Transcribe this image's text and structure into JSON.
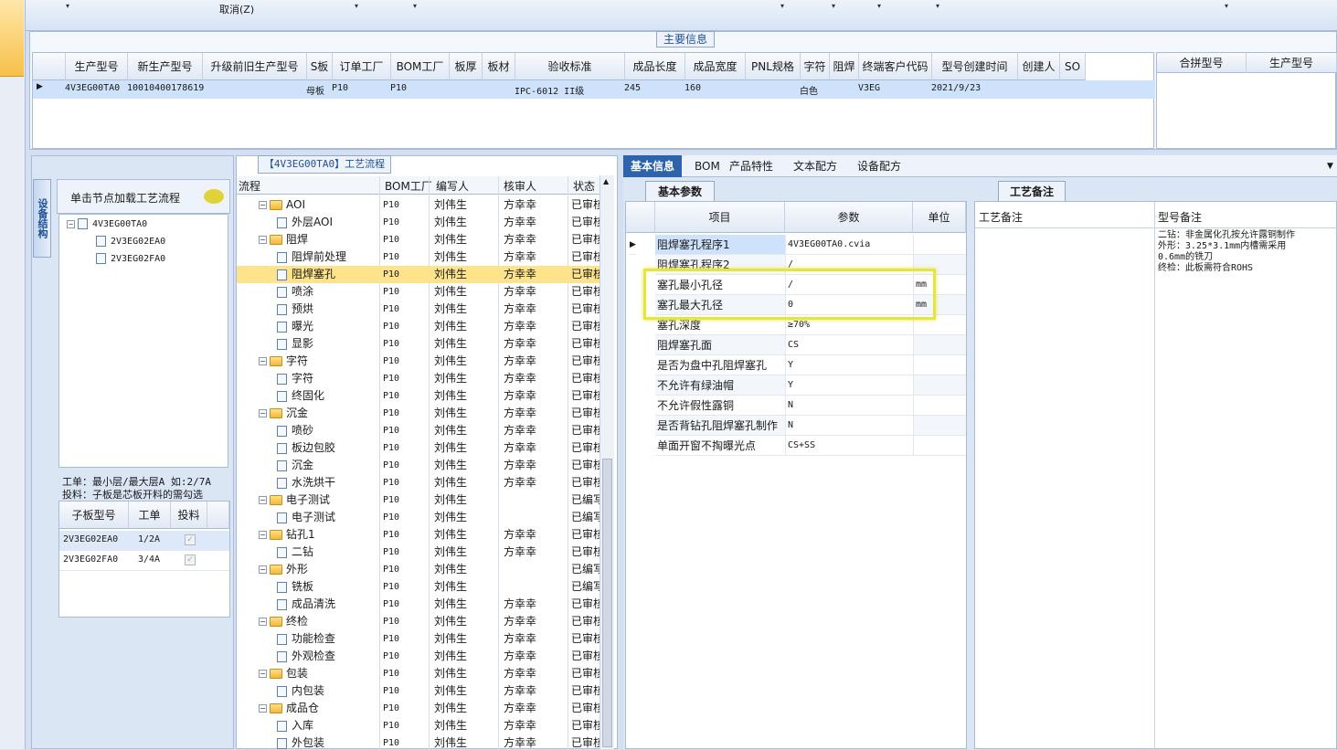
{
  "toolbar": {
    "cancel_label": "取消(Z)"
  },
  "main_info": {
    "title": "主要信息",
    "columns": [
      "生产型号",
      "新生产型号",
      "升级前旧生产型号",
      "S板",
      "订单工厂",
      "BOM工厂",
      "板厚",
      "板材",
      "验收标准",
      "成品长度",
      "成品宽度",
      "PNL规格",
      "字符",
      "阻焊",
      "终端客户代码",
      "型号创建时间",
      "创建人",
      "SO"
    ],
    "row": {
      "生产型号": "4V3EG00TA0",
      "新生产型号": "10010400178619",
      "S板": "母板",
      "订单工厂": "P10",
      "BOM工厂": "P10",
      "验收标准": "IPC-6012 II级",
      "成品长度": "245",
      "成品宽度": "160",
      "字符": "白色",
      "终端客户代码": "V3EG",
      "型号创建时间": "2021/9/23"
    },
    "merge_columns": [
      "合拼型号",
      "生产型号"
    ]
  },
  "left": {
    "vertical_tab": "设备结构",
    "click_hint": "单击节点加载工艺流程",
    "tree": [
      "4V3EG00TA0",
      "2V3EG02EA0",
      "2V3EG02FA0"
    ],
    "note_line1": "工单：最小层/最大层A 如:2/7A",
    "note_line2": "投料：子板是芯板开料的需勾选",
    "subgrid_columns": [
      "子板型号",
      "工单",
      "投料"
    ],
    "subgrid_rows": [
      {
        "model": "2V3EG02EA0",
        "ticket": "1/2A"
      },
      {
        "model": "2V3EG02FA0",
        "ticket": "3/4A"
      }
    ]
  },
  "process": {
    "title": "【4V3EG00TA0】工艺流程",
    "columns": [
      "流程",
      "BOM工厂",
      "编写人",
      "核审人",
      "状态"
    ],
    "rows": [
      {
        "name": "AOI",
        "level": 0,
        "factory": "P10",
        "writer": "刘伟生",
        "reviewer": "方幸幸",
        "status": "已审核"
      },
      {
        "name": "外层AOI",
        "level": 1,
        "factory": "P10",
        "writer": "刘伟生",
        "reviewer": "方幸幸",
        "status": "已审核"
      },
      {
        "name": "阻焊",
        "level": 0,
        "factory": "P10",
        "writer": "刘伟生",
        "reviewer": "方幸幸",
        "status": "已审核"
      },
      {
        "name": "阻焊前处理",
        "level": 1,
        "factory": "P10",
        "writer": "刘伟生",
        "reviewer": "方幸幸",
        "status": "已审核"
      },
      {
        "name": "阻焊塞孔",
        "level": 1,
        "factory": "P10",
        "writer": "刘伟生",
        "reviewer": "方幸幸",
        "status": "已审核",
        "selected": true
      },
      {
        "name": "喷涂",
        "level": 1,
        "factory": "P10",
        "writer": "刘伟生",
        "reviewer": "方幸幸",
        "status": "已审核"
      },
      {
        "name": "预烘",
        "level": 1,
        "factory": "P10",
        "writer": "刘伟生",
        "reviewer": "方幸幸",
        "status": "已审核"
      },
      {
        "name": "曝光",
        "level": 1,
        "factory": "P10",
        "writer": "刘伟生",
        "reviewer": "方幸幸",
        "status": "已审核"
      },
      {
        "name": "显影",
        "level": 1,
        "factory": "P10",
        "writer": "刘伟生",
        "reviewer": "方幸幸",
        "status": "已审核"
      },
      {
        "name": "字符",
        "level": 0,
        "factory": "P10",
        "writer": "刘伟生",
        "reviewer": "方幸幸",
        "status": "已审核"
      },
      {
        "name": "字符",
        "level": 1,
        "factory": "P10",
        "writer": "刘伟生",
        "reviewer": "方幸幸",
        "status": "已审核"
      },
      {
        "name": "终固化",
        "level": 1,
        "factory": "P10",
        "writer": "刘伟生",
        "reviewer": "方幸幸",
        "status": "已审核"
      },
      {
        "name": "沉金",
        "level": 0,
        "factory": "P10",
        "writer": "刘伟生",
        "reviewer": "方幸幸",
        "status": "已审核"
      },
      {
        "name": "喷砂",
        "level": 1,
        "factory": "P10",
        "writer": "刘伟生",
        "reviewer": "方幸幸",
        "status": "已审核"
      },
      {
        "name": "板边包胶",
        "level": 1,
        "factory": "P10",
        "writer": "刘伟生",
        "reviewer": "方幸幸",
        "status": "已审核"
      },
      {
        "name": "沉金",
        "level": 1,
        "factory": "P10",
        "writer": "刘伟生",
        "reviewer": "方幸幸",
        "status": "已审核"
      },
      {
        "name": "水洗烘干",
        "level": 1,
        "factory": "P10",
        "writer": "刘伟生",
        "reviewer": "方幸幸",
        "status": "已审核"
      },
      {
        "name": "电子测试",
        "level": 0,
        "factory": "P10",
        "writer": "刘伟生",
        "reviewer": "",
        "status": "已编写"
      },
      {
        "name": "电子测试",
        "level": 1,
        "factory": "P10",
        "writer": "刘伟生",
        "reviewer": "",
        "status": "已编写"
      },
      {
        "name": "钻孔1",
        "level": 0,
        "factory": "P10",
        "writer": "刘伟生",
        "reviewer": "方幸幸",
        "status": "已审核"
      },
      {
        "name": "二钻",
        "level": 1,
        "factory": "P10",
        "writer": "刘伟生",
        "reviewer": "方幸幸",
        "status": "已审核"
      },
      {
        "name": "外形",
        "level": 0,
        "factory": "P10",
        "writer": "刘伟生",
        "reviewer": "",
        "status": "已编写"
      },
      {
        "name": "铣板",
        "level": 1,
        "factory": "P10",
        "writer": "刘伟生",
        "reviewer": "",
        "status": "已编写"
      },
      {
        "name": "成品清洗",
        "level": 1,
        "factory": "P10",
        "writer": "刘伟生",
        "reviewer": "方幸幸",
        "status": "已审核"
      },
      {
        "name": "终检",
        "level": 0,
        "factory": "P10",
        "writer": "刘伟生",
        "reviewer": "方幸幸",
        "status": "已审核"
      },
      {
        "name": "功能检查",
        "level": 1,
        "factory": "P10",
        "writer": "刘伟生",
        "reviewer": "方幸幸",
        "status": "已审核"
      },
      {
        "name": "外观检查",
        "level": 1,
        "factory": "P10",
        "writer": "刘伟生",
        "reviewer": "方幸幸",
        "status": "已审核"
      },
      {
        "name": "包装",
        "level": 0,
        "factory": "P10",
        "writer": "刘伟生",
        "reviewer": "方幸幸",
        "status": "已审核"
      },
      {
        "name": "内包装",
        "level": 1,
        "factory": "P10",
        "writer": "刘伟生",
        "reviewer": "方幸幸",
        "status": "已审核"
      },
      {
        "name": "成品仓",
        "level": 0,
        "factory": "P10",
        "writer": "刘伟生",
        "reviewer": "方幸幸",
        "status": "已审核"
      },
      {
        "name": "入库",
        "level": 1,
        "factory": "P10",
        "writer": "刘伟生",
        "reviewer": "方幸幸",
        "status": "已审核"
      },
      {
        "name": "外包装",
        "level": 1,
        "factory": "P10",
        "writer": "刘伟生",
        "reviewer": "方幸幸",
        "status": "已审核"
      }
    ]
  },
  "right": {
    "tabs": [
      "基本信息",
      "BOM",
      "产品特性",
      "文本配方",
      "设备配方"
    ],
    "sub_tab": "基本参数",
    "param_columns": [
      "项目",
      "参数",
      "单位"
    ],
    "params": [
      {
        "item": "阻焊塞孔程序1",
        "value": "4V3EG00TA0.cvia",
        "unit": ""
      },
      {
        "item": "阻焊塞孔程序2",
        "value": "/",
        "unit": ""
      },
      {
        "item": "塞孔最小孔径",
        "value": "/",
        "unit": "mm"
      },
      {
        "item": "塞孔最大孔径",
        "value": "0",
        "unit": "mm"
      },
      {
        "item": "塞孔深度",
        "value": "≥70%",
        "unit": ""
      },
      {
        "item": "阻焊塞孔面",
        "value": "CS",
        "unit": ""
      },
      {
        "item": "是否为盘中孔阻焊塞孔",
        "value": "Y",
        "unit": ""
      },
      {
        "item": "不允许有绿油帽",
        "value": "Y",
        "unit": ""
      },
      {
        "item": "不允许假性露铜",
        "value": "N",
        "unit": ""
      },
      {
        "item": "是否背钻孔阻焊塞孔制作",
        "value": "N",
        "unit": ""
      },
      {
        "item": "单面开窗不掏曝光点",
        "value": "CS+SS",
        "unit": ""
      }
    ],
    "remark_tab": "工艺备注",
    "remark_columns": [
      "工艺备注",
      "型号备注"
    ],
    "model_remark": [
      "二钻：非金属化孔按允许露铜制作",
      "外形：3.25*3.1mm内槽需采用",
      "0.6mm的铣刀",
      "终检：此板需符合ROHS"
    ]
  }
}
